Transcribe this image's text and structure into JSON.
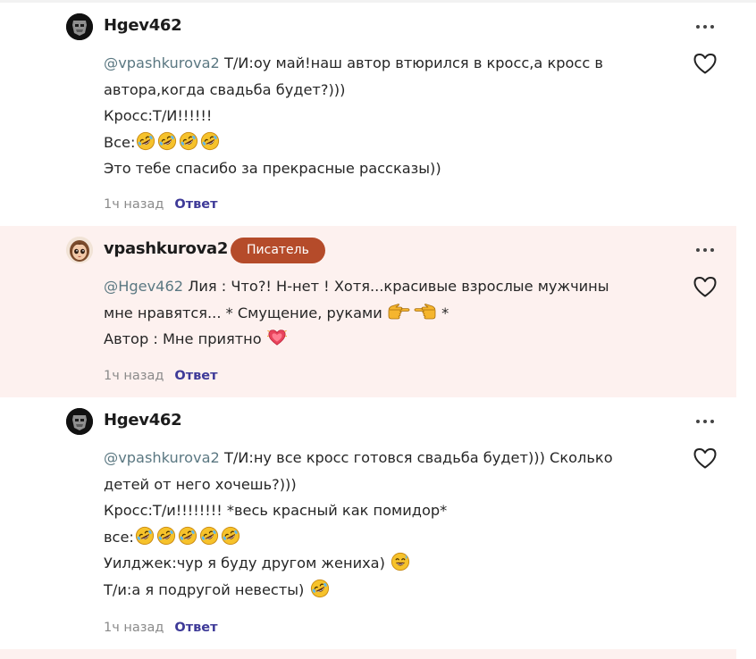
{
  "comments": [
    {
      "username": "Hgev462",
      "badge": "",
      "mention": "@vpashkurova2",
      "lines": [
        " Т/И:оу май!наш автор втюрился в кросс,а кросс в",
        "автора,когда свадьба будет?)))",
        "Кросс:Т/И!!!!!!",
        "Все:",
        "Это тебе спасибо за прекрасные рассказы))"
      ],
      "time": "1ч назад",
      "reply": "Ответ"
    },
    {
      "username": "vpashkurova2",
      "badge": "Писатель",
      "mention": "@Hgev462",
      "lines": [
        " Лия : Что?! Н-нет ! Хотя...красивые взрослые мужчины",
        "мне нравятся... * Смущение, руками ",
        "Автор : Мне приятно "
      ],
      "time": "1ч назад",
      "reply": "Ответ"
    },
    {
      "username": "Hgev462",
      "badge": "",
      "mention": "@vpashkurova2",
      "lines": [
        " Т/И:ну все кросс готовся свадьба будет))) Сколько",
        "детей от него хочешь?)))",
        "Кросс:Т/и!!!!!!!! *весь красный как помидор*",
        "все:",
        "Уилджек:чур я буду другом жениха) ",
        "Т/и:а я подругой невесты) "
      ],
      "time": "1ч назад",
      "reply": "Ответ"
    }
  ],
  "line2_suffix": " *",
  "icons": {
    "menu": "more-dots-icon",
    "like": "heart-outline-icon",
    "laugh": "rolling-on-floor-laughing-emoji",
    "tears": "grinning-sweat-emoji",
    "fingers": "pointing-fingers-emoji",
    "heart": "growing-heart-emoji"
  },
  "colors": {
    "highlight_bg": "#fdf1ef",
    "badge_bg": "#b54b2a",
    "mention": "#5b7882",
    "reply": "#3e3a98",
    "time": "#8a8a8a"
  }
}
